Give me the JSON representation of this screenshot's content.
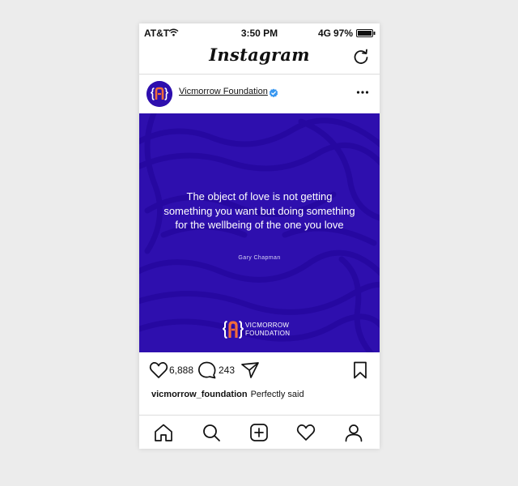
{
  "status_bar": {
    "carrier": "AT&T",
    "time": "3:50 PM",
    "network": "4G",
    "battery": "97%",
    "wifi_icon": "wifi-icon",
    "battery_icon": "battery-icon"
  },
  "app": {
    "title": "Instagram",
    "refresh_icon": "refresh-icon"
  },
  "post": {
    "account_name": "Vicmorrow Foundation",
    "verified_icon": "verified-badge-icon",
    "more_icon": "more-options-icon",
    "image": {
      "quote": "The object of love is not getting something you want but doing something for the wellbeing of the one you love",
      "author": "Gary Chapman",
      "brand_line1": "VICMORROW",
      "brand_line2": "FOUNDATION",
      "background_color": "#2e0fae",
      "accent_color": "#f26b3a"
    },
    "likes": "6,888",
    "comments": "243",
    "caption_user": "vicmorrow_foundation",
    "caption_text": "Perfectly said"
  },
  "bottom_nav": {
    "items": [
      "home-icon",
      "search-icon",
      "new-post-icon",
      "activity-heart-icon",
      "profile-icon"
    ]
  }
}
